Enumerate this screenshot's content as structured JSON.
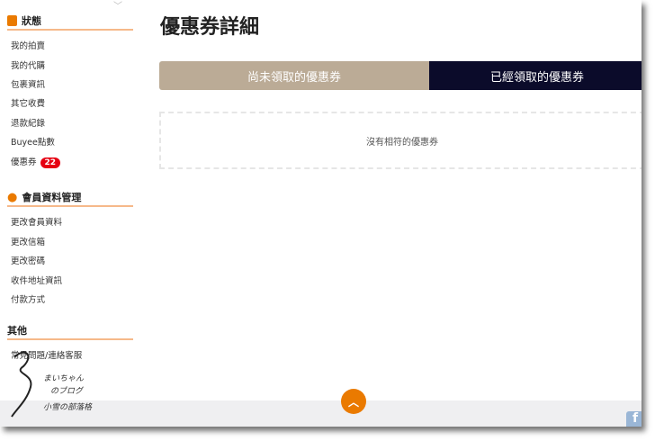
{
  "sidebar": {
    "status": {
      "title": "狀態",
      "items": [
        "我的拍賣",
        "我的代購",
        "包裹資訊",
        "其它收費",
        "退款紀錄",
        "Buyee點數",
        "優惠券"
      ],
      "coupon_badge": "22"
    },
    "member": {
      "title": "會員資料管理",
      "items": [
        "更改會員資料",
        "更改信箱",
        "更改密碼",
        "收件地址資訊",
        "付款方式"
      ]
    },
    "other": {
      "title": "其他",
      "items": [
        "常見問題/連絡客服"
      ]
    }
  },
  "main": {
    "title": "優惠券詳細",
    "tabs": [
      "尚未領取的優惠券",
      "已經領取的優惠券"
    ],
    "empty_message": "沒有相符的優惠券"
  },
  "watermark": {
    "line1": "まいちゃん",
    "line2": "のブログ",
    "line3": "小雪の部落格"
  },
  "colors": {
    "accent": "#ea7a00",
    "tab_inactive": "#bbab96",
    "tab_active": "#0b0b2a",
    "badge": "#e60012"
  }
}
